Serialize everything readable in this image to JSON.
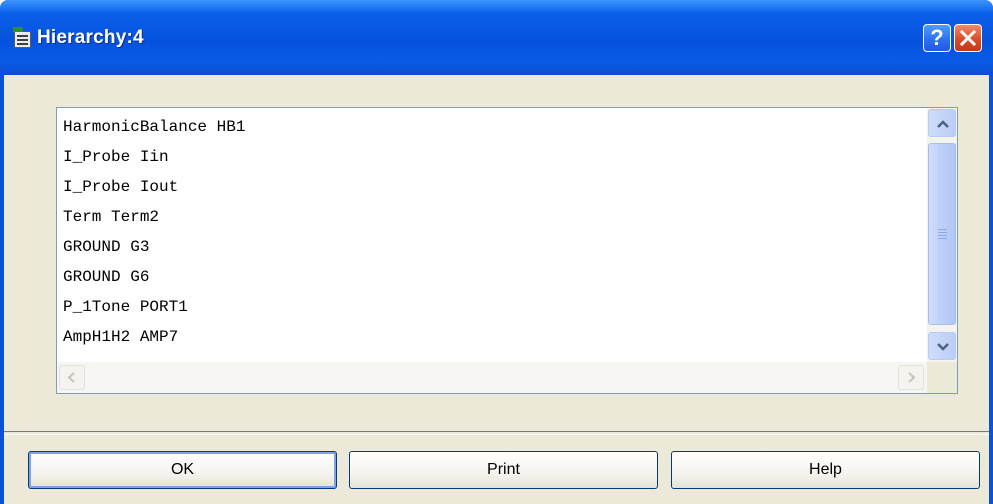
{
  "window": {
    "title": "Hierarchy:4",
    "help_glyph": "?",
    "accent_color": "#0a52d6",
    "close_color": "#dd4c28"
  },
  "list": {
    "items": [
      "HarmonicBalance HB1",
      "I_Probe Iin",
      "I_Probe Iout",
      "Term Term2",
      "GROUND G3",
      "GROUND G6",
      "P_1Tone PORT1",
      "AmpH1H2 AMP7"
    ]
  },
  "buttons": {
    "ok": "OK",
    "print": "Print",
    "help": "Help"
  }
}
